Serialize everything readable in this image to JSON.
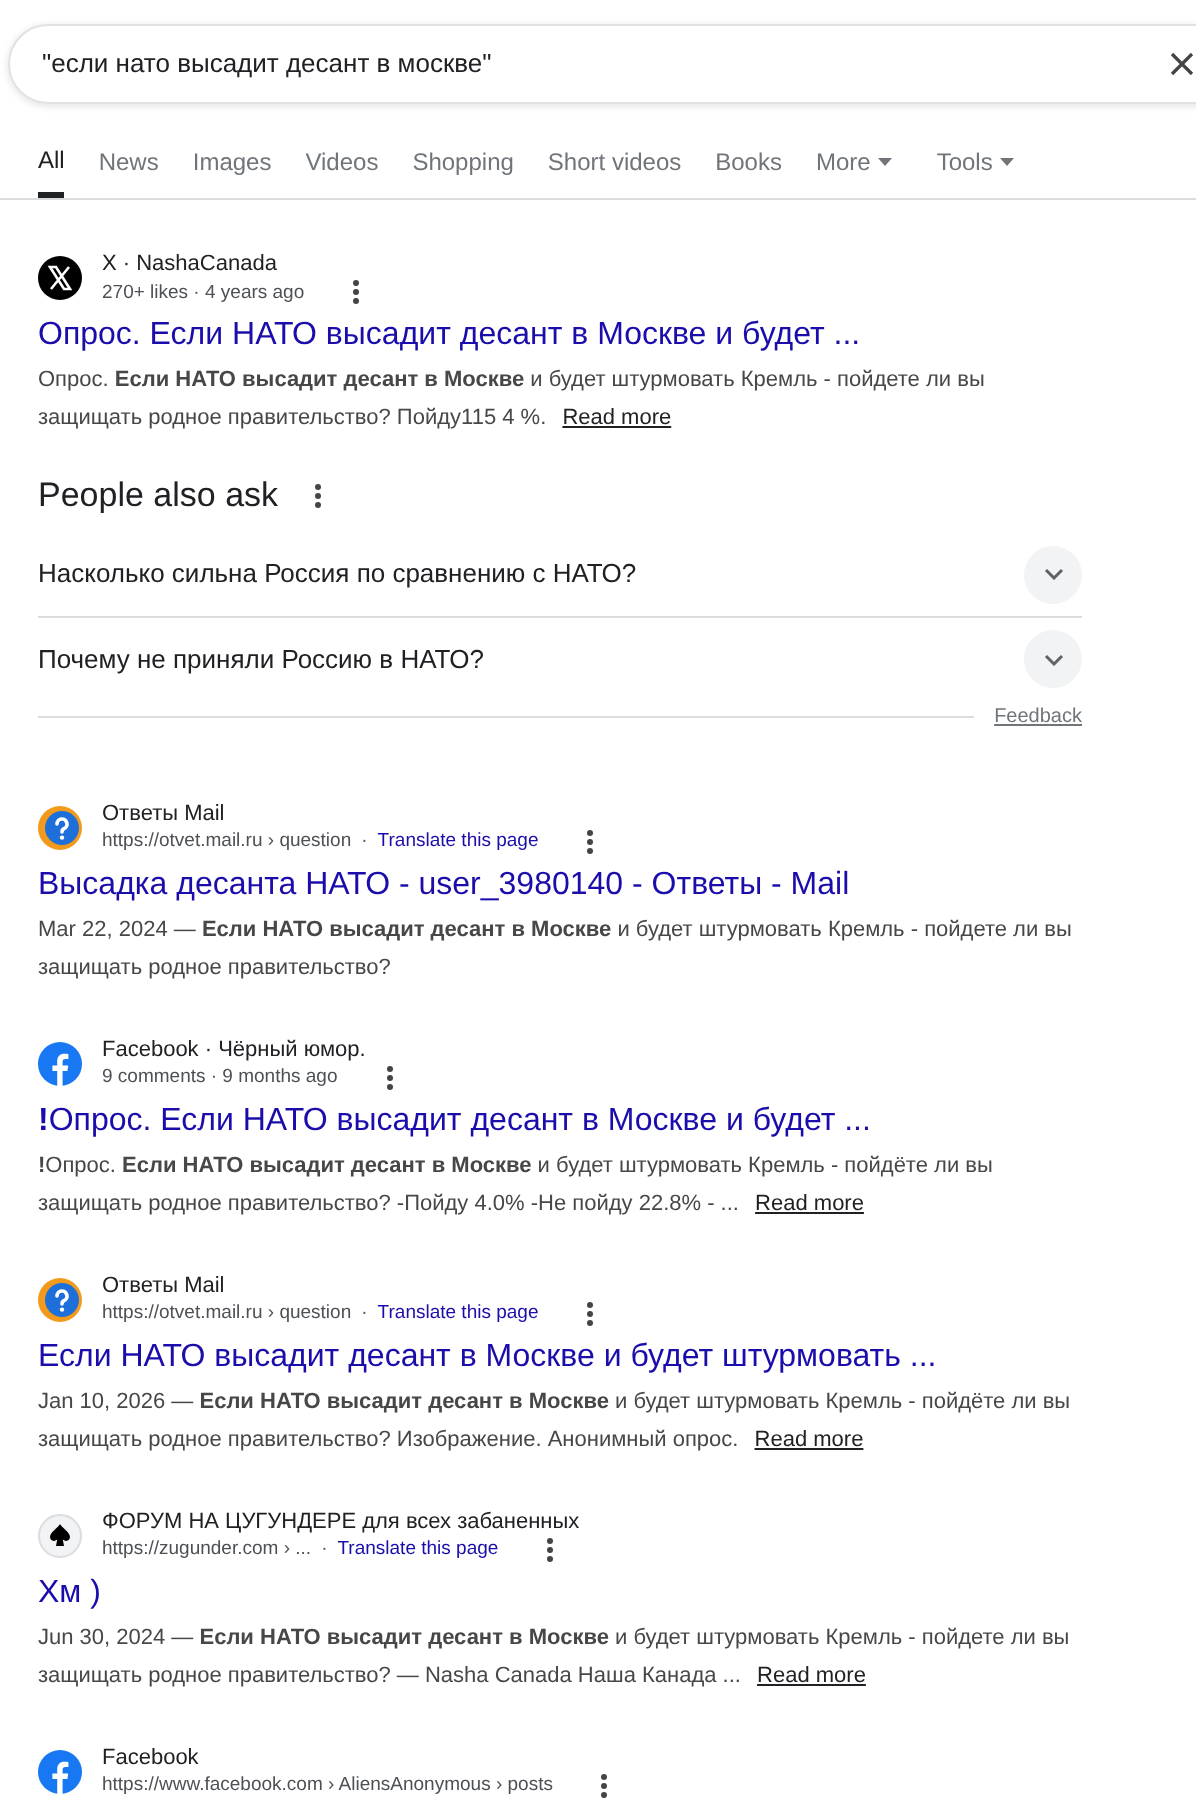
{
  "search": {
    "value": "\"если нато высадит десант в москве\""
  },
  "tabs": [
    {
      "label": "All",
      "selected": true,
      "kind": "plain"
    },
    {
      "label": "News",
      "selected": false,
      "kind": "plain"
    },
    {
      "label": "Images",
      "selected": false,
      "kind": "plain"
    },
    {
      "label": "Videos",
      "selected": false,
      "kind": "plain"
    },
    {
      "label": "Shopping",
      "selected": false,
      "kind": "plain"
    },
    {
      "label": "Short videos",
      "selected": false,
      "kind": "plain"
    },
    {
      "label": "Books",
      "selected": false,
      "kind": "plain"
    },
    {
      "label": "More",
      "selected": false,
      "kind": "dropdown"
    },
    {
      "label": "Tools",
      "selected": false,
      "kind": "dropdown"
    }
  ],
  "results_top": [
    {
      "kind": "x",
      "site": "X · NashaCanada",
      "meta": "270+ likes · 4 years ago",
      "title": "Опрос. Если НАТО высадит десант в Москве и будет ...",
      "snippet": "Опрос. **Если НАТО высадит десант в Москве** и будет штурмовать Кремль - пойдете ли вы защищать родное правительство? Пойду115 4 %.",
      "read_more": "Read more"
    }
  ],
  "people_also_ask": {
    "title": "People also ask",
    "questions": [
      {
        "text": "Насколько сильна Россия по сравнению с НАТО?",
        "expanded": false
      },
      {
        "text": "Почему не приняли Россию в НАТО?",
        "expanded": false
      }
    ],
    "feedback": "Feedback"
  },
  "results": [
    {
      "kind": "answers",
      "site": "Ответы Mail",
      "meta": "https://otvet.mail.ru › question",
      "separator": "·",
      "translate": "Translate this page",
      "title": "Высадка десанта НАТО - user_3980140 - Ответы - Mail",
      "snippet": "Mar 22, 2024 — **Если НАТО высадит десант в Москве** и будет штурмовать Кремль - пойдете ли вы защищать родное правительство?"
    },
    {
      "kind": "facebook",
      "site": "Facebook · Чёрный юмор.",
      "meta": "9 comments · 9 months ago",
      "title": "**!**Опрос. Если НАТО высадит десант в Москве и будет ...",
      "snippet": "**!**Опрос. **Если НАТО высадит десант в Москве** и будет штурмовать Кремль - пойдёте ли вы защищать родное правительство? -Пойду 4.0% -Не пойду 22.8% - ...",
      "read_more": "Read more"
    },
    {
      "kind": "answers",
      "site": "Ответы Mail",
      "meta": "https://otvet.mail.ru › question",
      "separator": "·",
      "translate": "Translate this page",
      "title": "Если НАТО высадит десант в Москве и будет штурмовать ...",
      "snippet": "Jan 10, 2026 — **Если НАТО высадит десант в Москве** и будет штурмовать Кремль - пойдёте ли вы защищать родное правительство? Изображение. Анонимный опрос.",
      "read_more": "Read more"
    },
    {
      "kind": "spade",
      "site": "ФОРУМ НА ЦУГУНДЕРЕ для всех забаненных",
      "meta": "https://zugunder.com › ...",
      "separator": "·",
      "translate": "Translate this page",
      "title": "Хм )",
      "snippet": "Jun 30, 2024 — **Если НАТО высадит десант в Москве** и будет штурмовать Кремль - пойдете ли вы защищать родное правительство? — Nasha Canada Наша Канада ...",
      "read_more": "Read more"
    },
    {
      "kind": "facebook",
      "site": "Facebook",
      "meta": "https://www.facebook.com › AliensAnonymous › posts"
    }
  ]
}
